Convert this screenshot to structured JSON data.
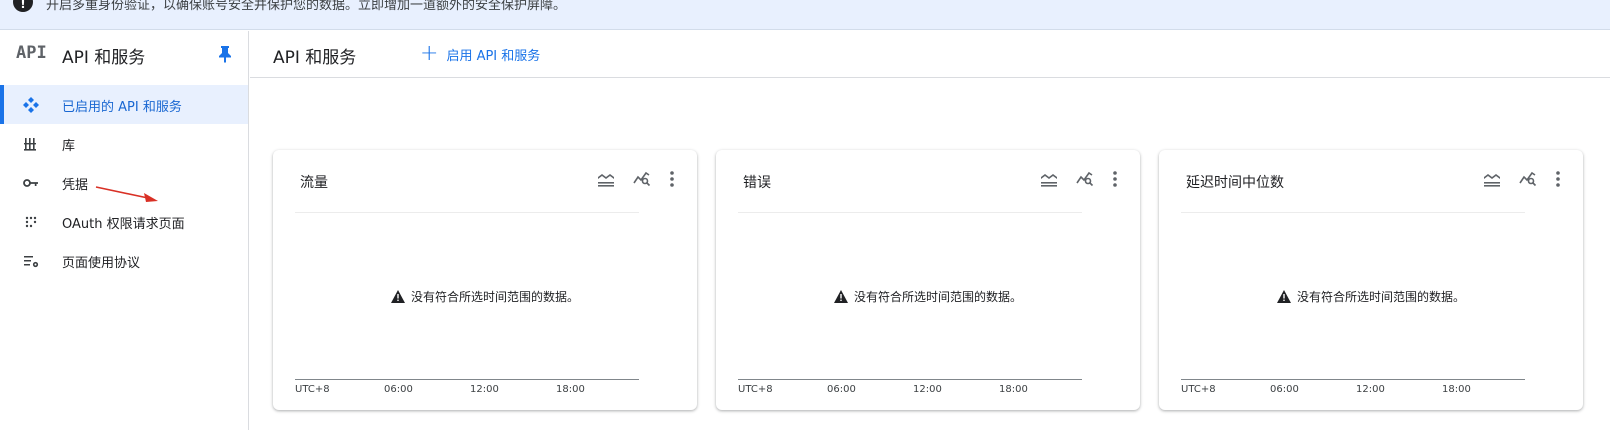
{
  "banner": {
    "text": "开启多重身份验证，以确保账号安全并保护您的数据。立即增加一道额外的安全保护屏障。"
  },
  "sidebar": {
    "logo": "API",
    "title": "API 和服务",
    "items": [
      {
        "label": "已启用的 API 和服务",
        "icon": "api-hub-icon",
        "active": true
      },
      {
        "label": "库",
        "icon": "library-icon",
        "active": false
      },
      {
        "label": "凭据",
        "icon": "key-icon",
        "active": false
      },
      {
        "label": "OAuth 权限请求页面",
        "icon": "oauth-dots-icon",
        "active": false
      },
      {
        "label": "页面使用协议",
        "icon": "settings-list-icon",
        "active": false
      }
    ]
  },
  "header": {
    "title": "API 和服务",
    "enable_button": "启用 API 和服务"
  },
  "cards": [
    {
      "title": "流量",
      "message": "没有符合所选时间范围的数据。",
      "ticks": [
        "UTC+8",
        "06:00",
        "12:00",
        "18:00"
      ]
    },
    {
      "title": "错误",
      "message": "没有符合所选时间范围的数据。",
      "ticks": [
        "UTC+8",
        "06:00",
        "12:00",
        "18:00"
      ]
    },
    {
      "title": "延迟时间中位数",
      "message": "没有符合所选时间范围的数据。",
      "ticks": [
        "UTC+8",
        "06:00",
        "12:00",
        "18:00"
      ]
    }
  ],
  "colors": {
    "accent": "#1a73e8",
    "active_bg": "#e8f0fe",
    "annotation_arrow": "#d93025"
  }
}
